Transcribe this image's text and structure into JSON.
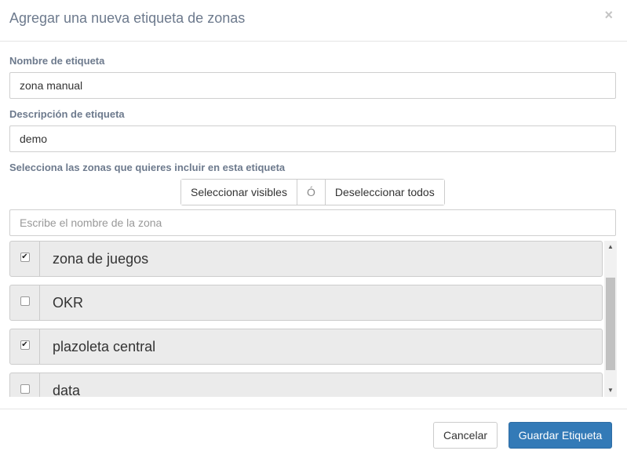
{
  "modal": {
    "title": "Agregar una nueva etiqueta de zonas",
    "close_glyph": "×"
  },
  "form": {
    "name_label": "Nombre de etiqueta",
    "name_value": "zona manual",
    "description_label": "Descripción de etiqueta",
    "description_value": "demo",
    "zones_label": "Selecciona las zonas que quieres incluir en esta etiqueta"
  },
  "selection_buttons": {
    "select_visible": "Seleccionar visibles",
    "separator": "Ó",
    "deselect_all": "Deseleccionar todos"
  },
  "search": {
    "placeholder": "Escribe el nombre de la zona"
  },
  "zones": [
    {
      "name": "zona de juegos",
      "checked": true,
      "check_glyph": "✔"
    },
    {
      "name": "OKR",
      "checked": false,
      "check_glyph": ""
    },
    {
      "name": "plazoleta central",
      "checked": true,
      "check_glyph": "✔"
    },
    {
      "name": "data",
      "checked": false,
      "check_glyph": ""
    }
  ],
  "scrollbar": {
    "up_glyph": "▲",
    "down_glyph": "▼"
  },
  "footer": {
    "cancel_label": "Cancelar",
    "save_label": "Guardar Etiqueta"
  },
  "colors": {
    "primary": "#337ab7",
    "title_text": "#6d7a8d",
    "zone_background": "#ebebeb"
  }
}
